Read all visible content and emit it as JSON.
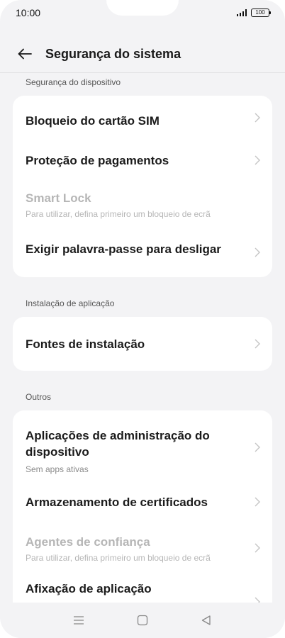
{
  "status": {
    "time": "10:00",
    "battery": "100"
  },
  "header": {
    "title": "Segurança do sistema"
  },
  "sections": [
    {
      "label": "Segurança do dispositivo",
      "items": [
        {
          "title": "Bloqueio do cartão SIM",
          "subtitle": "",
          "enabled": true
        },
        {
          "title": "Proteção de pagamentos",
          "subtitle": "",
          "enabled": true
        },
        {
          "title": "Smart Lock",
          "subtitle": "Para utilizar, defina primeiro um bloqueio de ecrã",
          "enabled": false
        },
        {
          "title": "Exigir palavra-passe para desligar",
          "subtitle": "",
          "enabled": true
        }
      ]
    },
    {
      "label": "Instalação de aplicação",
      "items": [
        {
          "title": "Fontes de instalação",
          "subtitle": "",
          "enabled": true
        }
      ]
    },
    {
      "label": "Outros",
      "items": [
        {
          "title": "Aplicações de administração do dispositivo",
          "subtitle": "Sem apps ativas",
          "enabled": true
        },
        {
          "title": "Armazenamento de certificados",
          "subtitle": "",
          "enabled": true
        },
        {
          "title": "Agentes de confiança",
          "subtitle": "Para utilizar, defina primeiro um bloqueio de ecrã",
          "enabled": false
        },
        {
          "title": "Afixação de aplicação",
          "subtitle": "",
          "enabled": true
        }
      ]
    }
  ],
  "icons": {
    "back": "arrow-left-icon",
    "chevron": "chevron-right-icon",
    "nav": [
      "menu-icon",
      "home-square-icon",
      "back-triangle-icon"
    ]
  },
  "colors": {
    "background": "#f3f3f5",
    "card": "#ffffff",
    "disabled_text": "#b6b6b6"
  }
}
